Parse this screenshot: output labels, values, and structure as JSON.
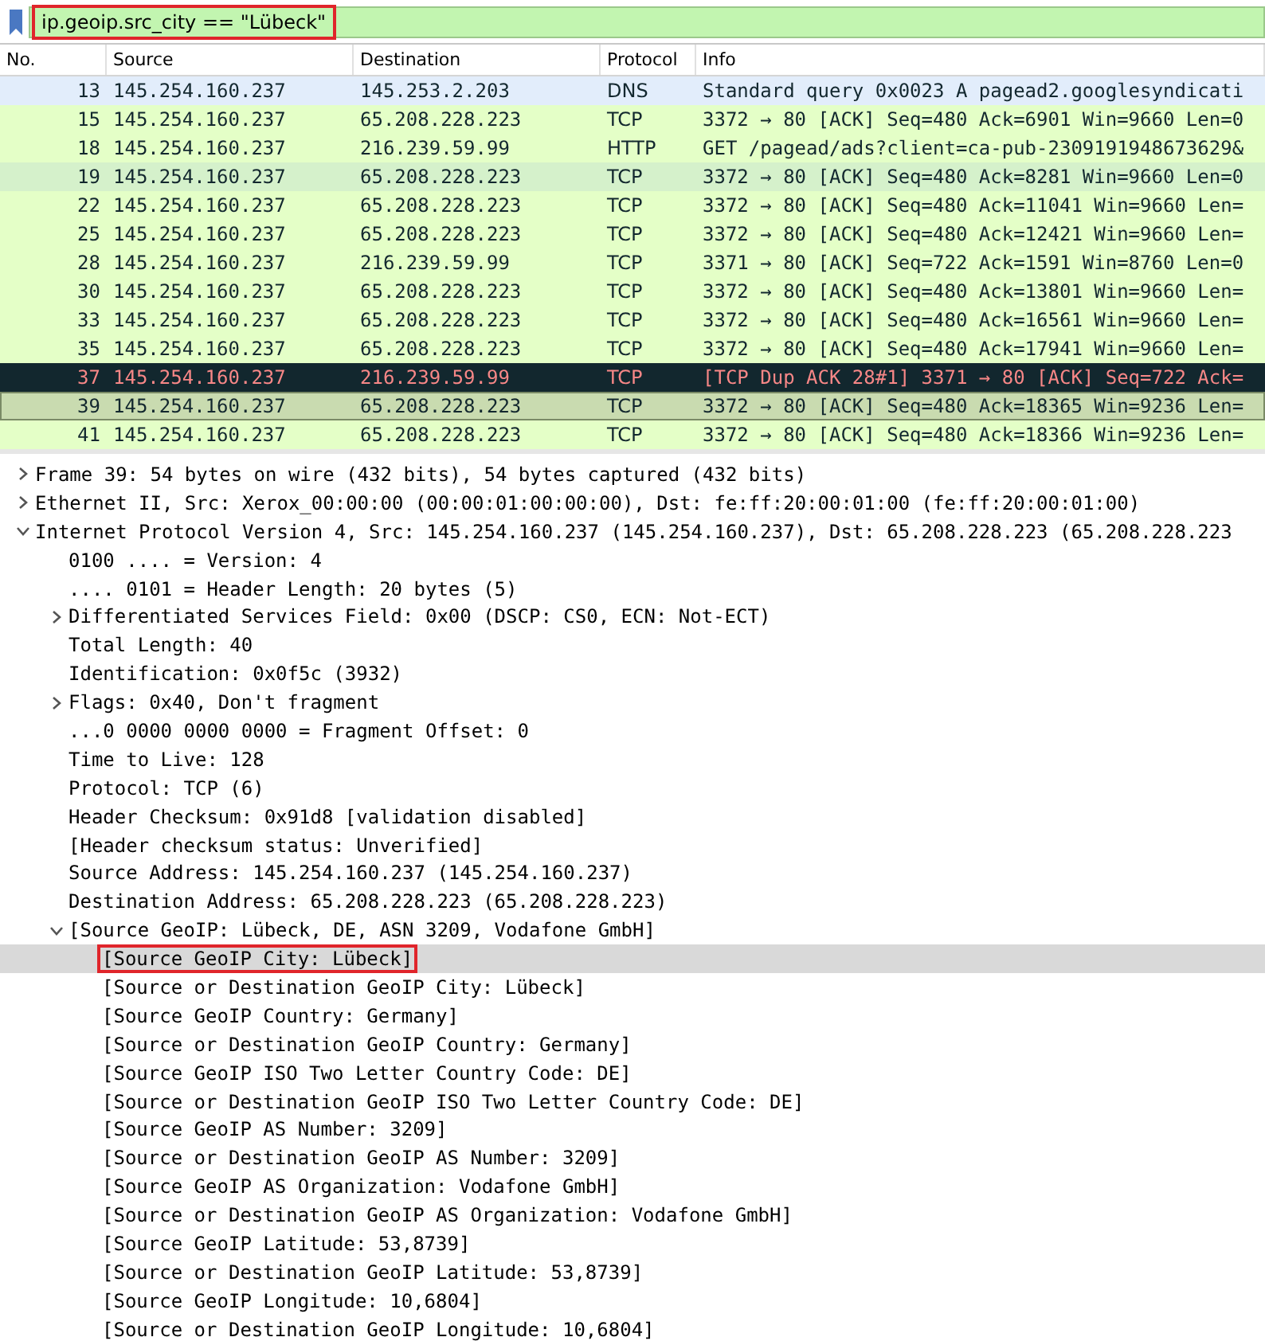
{
  "filter": {
    "value": "ip.geoip.src_city == \"Lübeck\"",
    "valid": true,
    "annotated": true
  },
  "packets": {
    "columns": [
      "No.",
      "Source",
      "Destination",
      "Protocol",
      "Info"
    ],
    "rows": [
      {
        "no": "13",
        "source": "145.254.160.237",
        "destination": "145.253.2.203",
        "protocol": "DNS",
        "info": "Standard query 0x0023 A pagead2.googlesyndicati",
        "color": "#e2edfb",
        "kind": "normal",
        "selected": false
      },
      {
        "no": "15",
        "source": "145.254.160.237",
        "destination": "65.208.228.223",
        "protocol": "TCP",
        "info": "3372 → 80 [ACK] Seq=480 Ack=6901 Win=9660 Len=0",
        "color": "#e4ffc7",
        "kind": "normal",
        "selected": false
      },
      {
        "no": "18",
        "source": "145.254.160.237",
        "destination": "216.239.59.99",
        "protocol": "HTTP",
        "info": "GET /pagead/ads?client=ca-pub-2309191948673629&",
        "color": "#e4ffc7",
        "kind": "normal",
        "selected": false
      },
      {
        "no": "19",
        "source": "145.254.160.237",
        "destination": "65.208.228.223",
        "protocol": "TCP",
        "info": "3372 → 80 [ACK] Seq=480 Ack=8281 Win=9660 Len=0",
        "color": "#d5f1cb",
        "kind": "normal",
        "selected": false
      },
      {
        "no": "22",
        "source": "145.254.160.237",
        "destination": "65.208.228.223",
        "protocol": "TCP",
        "info": "3372 → 80 [ACK] Seq=480 Ack=11041 Win=9660 Len=",
        "color": "#e4ffc7",
        "kind": "normal",
        "selected": false
      },
      {
        "no": "25",
        "source": "145.254.160.237",
        "destination": "65.208.228.223",
        "protocol": "TCP",
        "info": "3372 → 80 [ACK] Seq=480 Ack=12421 Win=9660 Len=",
        "color": "#e4ffc7",
        "kind": "normal",
        "selected": false
      },
      {
        "no": "28",
        "source": "145.254.160.237",
        "destination": "216.239.59.99",
        "protocol": "TCP",
        "info": "3371 → 80 [ACK] Seq=722 Ack=1591 Win=8760 Len=0",
        "color": "#e4ffc7",
        "kind": "normal",
        "selected": false
      },
      {
        "no": "30",
        "source": "145.254.160.237",
        "destination": "65.208.228.223",
        "protocol": "TCP",
        "info": "3372 → 80 [ACK] Seq=480 Ack=13801 Win=9660 Len=",
        "color": "#e4ffc7",
        "kind": "normal",
        "selected": false
      },
      {
        "no": "33",
        "source": "145.254.160.237",
        "destination": "65.208.228.223",
        "protocol": "TCP",
        "info": "3372 → 80 [ACK] Seq=480 Ack=16561 Win=9660 Len=",
        "color": "#e4ffc7",
        "kind": "normal",
        "selected": false
      },
      {
        "no": "35",
        "source": "145.254.160.237",
        "destination": "65.208.228.223",
        "protocol": "TCP",
        "info": "3372 → 80 [ACK] Seq=480 Ack=17941 Win=9660 Len=",
        "color": "#e4ffc7",
        "kind": "normal",
        "selected": false
      },
      {
        "no": "37",
        "source": "145.254.160.237",
        "destination": "216.239.59.99",
        "protocol": "TCP",
        "info": "[TCP Dup ACK 28#1] 3371 → 80 [ACK] Seq=722 Ack=",
        "color": "#12272e",
        "kind": "error",
        "selected": false
      },
      {
        "no": "39",
        "source": "145.254.160.237",
        "destination": "65.208.228.223",
        "protocol": "TCP",
        "info": "3372 → 80 [ACK] Seq=480 Ack=18365 Win=9236 Len=",
        "color": "#c9dbb0",
        "kind": "normal",
        "selected": true
      },
      {
        "no": "41",
        "source": "145.254.160.237",
        "destination": "65.208.228.223",
        "protocol": "TCP",
        "info": "3372 → 80 [ACK] Seq=480 Ack=18366 Win=9236 Len=",
        "color": "#e4ffc7",
        "kind": "normal",
        "selected": false
      }
    ]
  },
  "details": [
    {
      "text": "Frame 39: 54 bytes on wire (432 bits), 54 bytes captured (432 bits)",
      "expanded": false,
      "selected": false
    },
    {
      "text": "Ethernet II, Src: Xerox_00:00:00 (00:00:01:00:00:00), Dst: fe:ff:20:00:01:00 (fe:ff:20:00:01:00)",
      "expanded": false,
      "selected": false
    },
    {
      "text": "Internet Protocol Version 4, Src: 145.254.160.237 (145.254.160.237), Dst: 65.208.228.223 (65.208.228.223",
      "expanded": true,
      "selected": false,
      "children": [
        {
          "text": "0100 .... = Version: 4",
          "selected": false
        },
        {
          "text": ".... 0101 = Header Length: 20 bytes (5)",
          "selected": false
        },
        {
          "text": "Differentiated Services Field: 0x00 (DSCP: CS0, ECN: Not-ECT)",
          "expanded": false,
          "selected": false
        },
        {
          "text": "Total Length: 40",
          "selected": false
        },
        {
          "text": "Identification: 0x0f5c (3932)",
          "selected": false
        },
        {
          "text": "Flags: 0x40, Don't fragment",
          "expanded": false,
          "selected": false
        },
        {
          "text": "...0 0000 0000 0000 = Fragment Offset: 0",
          "selected": false
        },
        {
          "text": "Time to Live: 128",
          "selected": false
        },
        {
          "text": "Protocol: TCP (6)",
          "selected": false
        },
        {
          "text": "Header Checksum: 0x91d8 [validation disabled]",
          "selected": false
        },
        {
          "text": "[Header checksum status: Unverified]",
          "selected": false
        },
        {
          "text": "Source Address: 145.254.160.237 (145.254.160.237)",
          "selected": false
        },
        {
          "text": "Destination Address: 65.208.228.223 (65.208.228.223)",
          "selected": false
        },
        {
          "text": "[Source GeoIP: Lübeck, DE, ASN 3209, Vodafone GmbH]",
          "expanded": true,
          "selected": false,
          "children": [
            {
              "text": "[Source GeoIP City: Lübeck]",
              "selected": true,
              "annotated": true
            },
            {
              "text": "[Source or Destination GeoIP City: Lübeck]",
              "selected": false
            },
            {
              "text": "[Source GeoIP Country: Germany]",
              "selected": false
            },
            {
              "text": "[Source or Destination GeoIP Country: Germany]",
              "selected": false
            },
            {
              "text": "[Source GeoIP ISO Two Letter Country Code: DE]",
              "selected": false
            },
            {
              "text": "[Source or Destination GeoIP ISO Two Letter Country Code: DE]",
              "selected": false
            },
            {
              "text": "[Source GeoIP AS Number: 3209]",
              "selected": false
            },
            {
              "text": "[Source or Destination GeoIP AS Number: 3209]",
              "selected": false
            },
            {
              "text": "[Source GeoIP AS Organization: Vodafone GmbH]",
              "selected": false
            },
            {
              "text": "[Source or Destination GeoIP AS Organization: Vodafone GmbH]",
              "selected": false
            },
            {
              "text": "[Source GeoIP Latitude: 53,8739]",
              "selected": false
            },
            {
              "text": "[Source or Destination GeoIP Latitude: 53,8739]",
              "selected": false
            },
            {
              "text": "[Source GeoIP Longitude: 10,6804]",
              "selected": false
            },
            {
              "text": "[Source or Destination GeoIP Longitude: 10,6804]",
              "selected": false
            }
          ]
        }
      ]
    }
  ]
}
